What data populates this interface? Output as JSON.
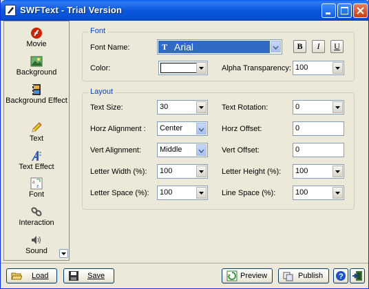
{
  "window": {
    "title": "SWFText - Trial Version"
  },
  "nav": {
    "items": [
      {
        "label": "Movie",
        "icon": "movie-icon"
      },
      {
        "label": "Background",
        "icon": "background-icon"
      },
      {
        "label": "Background Effect",
        "icon": "background-effect-icon"
      },
      {
        "label": "Text",
        "icon": "pencil-icon"
      },
      {
        "label": "Text Effect",
        "icon": "text-effect-icon"
      },
      {
        "label": "Font",
        "icon": "font-icon"
      },
      {
        "label": "Interaction",
        "icon": "interaction-icon"
      },
      {
        "label": "Sound",
        "icon": "sound-icon"
      }
    ]
  },
  "font_group": {
    "title": "Font",
    "font_name_label": "Font Name:",
    "font_name_value": "Arial",
    "bold": "B",
    "italic": "I",
    "underline": "U",
    "color_label": "Color:",
    "color_value": "#ffffff",
    "alpha_label": "Alpha Transparency:",
    "alpha_value": "100"
  },
  "layout_group": {
    "title": "Layout",
    "text_size_label": "Text Size:",
    "text_size_value": "30",
    "text_rotation_label": "Text Rotation:",
    "text_rotation_value": "0",
    "horz_align_label": "Horz Alignment :",
    "horz_align_value": "Center",
    "horz_offset_label": "Horz Offset:",
    "horz_offset_value": "0",
    "vert_align_label": "Vert Alignment:",
    "vert_align_value": "Middle",
    "vert_offset_label": "Vert Offset:",
    "vert_offset_value": "0",
    "letter_width_label": "Letter Width (%):",
    "letter_width_value": "100",
    "letter_height_label": "Letter Height (%):",
    "letter_height_value": "100",
    "letter_space_label": "Letter Space (%):",
    "letter_space_value": "100",
    "line_space_label": "Line Space (%):",
    "line_space_value": "100"
  },
  "footer": {
    "load": "Load",
    "save": "Save",
    "preview": "Preview",
    "publish": "Publish"
  },
  "colors": {
    "title_bar": "#0b58de",
    "group_title": "#0046d5",
    "face": "#ece9d8"
  }
}
